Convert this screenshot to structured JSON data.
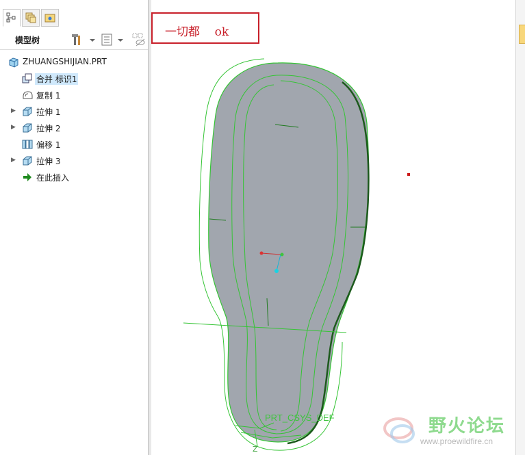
{
  "model_tree": {
    "title": "模型树",
    "part_name": "ZHUANGSHIJIAN.PRT",
    "features": [
      {
        "label": "合并 标识1",
        "icon": "merge-feature-icon",
        "selected": true,
        "expandable": false
      },
      {
        "label": "复制 1",
        "icon": "copy-feature-icon",
        "selected": false,
        "expandable": false
      },
      {
        "label": "拉伸 1",
        "icon": "extrude-feature-icon",
        "selected": false,
        "expandable": true
      },
      {
        "label": "拉伸 2",
        "icon": "extrude-feature-icon",
        "selected": false,
        "expandable": true
      },
      {
        "label": "偏移 1",
        "icon": "offset-feature-icon",
        "selected": false,
        "expandable": false
      },
      {
        "label": "拉伸 3",
        "icon": "extrude-feature-icon",
        "selected": false,
        "expandable": true
      },
      {
        "label": "在此插入",
        "icon": "insert-here-arrow-icon",
        "selected": false,
        "expandable": false
      }
    ]
  },
  "tabs": [
    "model-tree-tab-icon",
    "layers-tab-icon",
    "folder-browser-tab-icon"
  ],
  "viewport": {
    "annotation": "一切都    ok",
    "csys_label": "PRT_CSYS_DEF",
    "axis_z": "Z"
  },
  "watermark": {
    "title": "野火论坛",
    "url": "www.proewildfire.cn"
  },
  "colors": {
    "solid_fill": "#a1a6ae",
    "edge_green": "#35c435",
    "dark_edge": "#1d5a1d",
    "annotation_red": "#c8202a",
    "selection": "#cfe8fb"
  }
}
